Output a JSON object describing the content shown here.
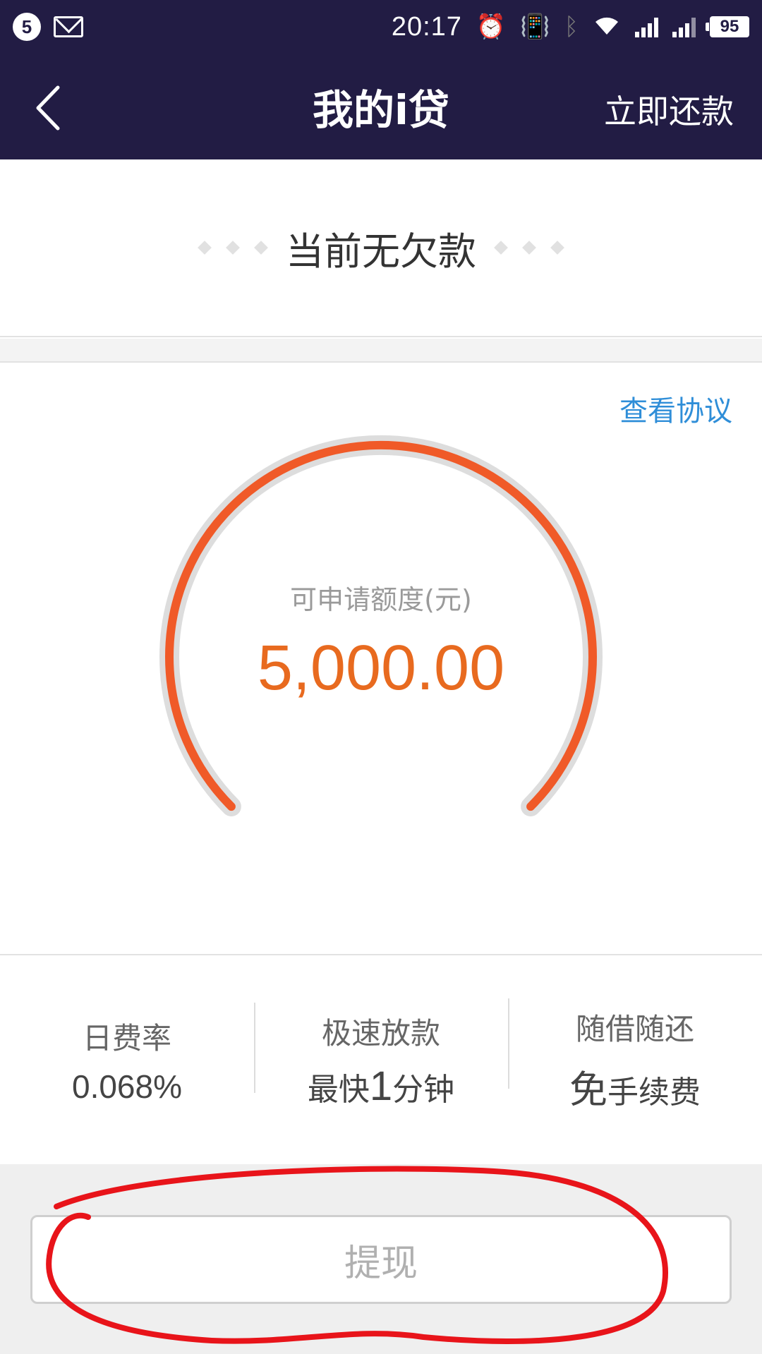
{
  "status_bar": {
    "notification_count": "5",
    "time": "20:17",
    "battery": "95",
    "icons": [
      "mail-icon",
      "alarm-icon",
      "vibrate-icon",
      "bluetooth-icon",
      "wifi-icon",
      "signal-icon"
    ]
  },
  "nav": {
    "title": "我的i贷",
    "action": "立即还款"
  },
  "debt": {
    "text": "当前无欠款"
  },
  "credit": {
    "agreement_link": "查看协议",
    "label": "可申请额度(元)",
    "amount": "5,000.00",
    "gauge_fraction": 1.0,
    "colors": {
      "arc": "#f05a28",
      "track": "#dddddd",
      "amount": "#e86a1f",
      "link": "#2f8ed8"
    }
  },
  "features": [
    {
      "title": "日费率",
      "value": "0.068%"
    },
    {
      "title": "极速放款",
      "prefix": "最快",
      "highlight": "1",
      "suffix": "分钟"
    },
    {
      "title": "随借随还",
      "highlight": "免",
      "suffix": "手续费"
    }
  ],
  "withdraw": {
    "label": "提现"
  }
}
